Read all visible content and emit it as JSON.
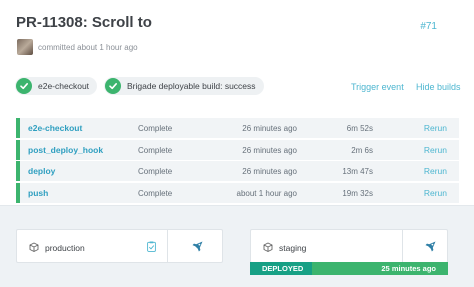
{
  "header": {
    "title": "PR-11308: Scroll to",
    "pr_number": "#71",
    "committed_text": "committed about 1 hour ago"
  },
  "checks": [
    {
      "label": "e2e-checkout",
      "status": "success"
    },
    {
      "label": "Brigade deployable build: success",
      "status": "success"
    }
  ],
  "actions": {
    "trigger_event": "Trigger event",
    "hide_builds": "Hide builds"
  },
  "jobs": [
    {
      "name": "e2e-checkout",
      "status": "Complete",
      "time": "26 minutes ago",
      "duration": "6m 52s",
      "action": "Rerun"
    },
    {
      "name": "post_deploy_hook",
      "status": "Complete",
      "time": "26 minutes ago",
      "duration": "2m 6s",
      "action": "Rerun"
    },
    {
      "name": "deploy",
      "status": "Complete",
      "time": "26 minutes ago",
      "duration": "13m 47s",
      "action": "Rerun"
    },
    {
      "name": "push",
      "status": "Complete",
      "time": "about 1 hour ago",
      "duration": "19m 32s",
      "action": "Rerun"
    }
  ],
  "environments": {
    "production": {
      "name": "production"
    },
    "staging": {
      "name": "staging",
      "status": "DEPLOYED",
      "time": "25 minutes ago"
    }
  },
  "colors": {
    "success": "#3cb46e",
    "link": "#4db6d0",
    "deployed": "#17a085"
  }
}
